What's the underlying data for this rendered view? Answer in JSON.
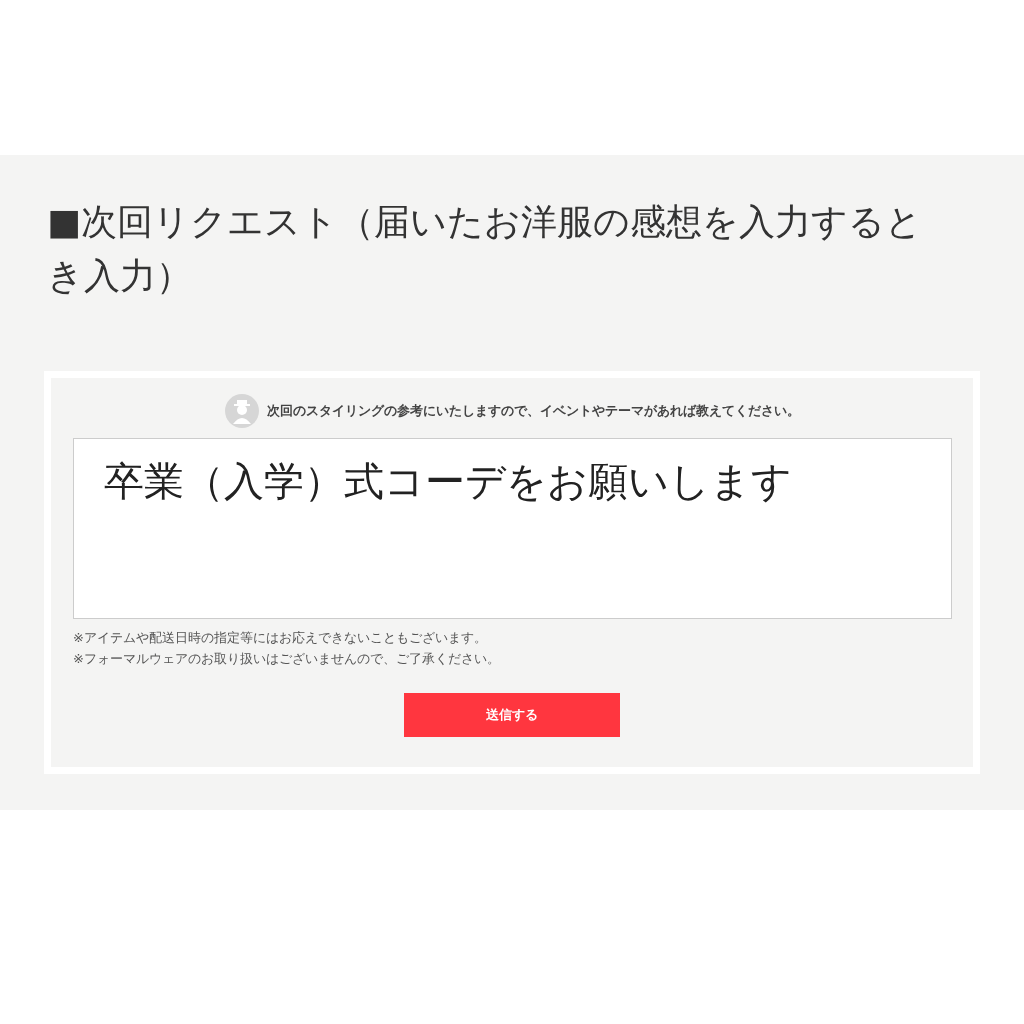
{
  "heading": "■次回リクエスト（届いたお洋服の感想を入力するとき入力）",
  "form": {
    "prompt": "次回のスタイリングの参考にいたしますので、イベントやテーマがあれば教えてください。",
    "answer": "卒業（入学）式コーデをお願いします",
    "notes": [
      "※アイテムや配送日時の指定等にはお応えできないこともございます。",
      "※フォーマルウェアのお取り扱いはございませんので、ご了承ください。"
    ],
    "submit": "送信する"
  }
}
